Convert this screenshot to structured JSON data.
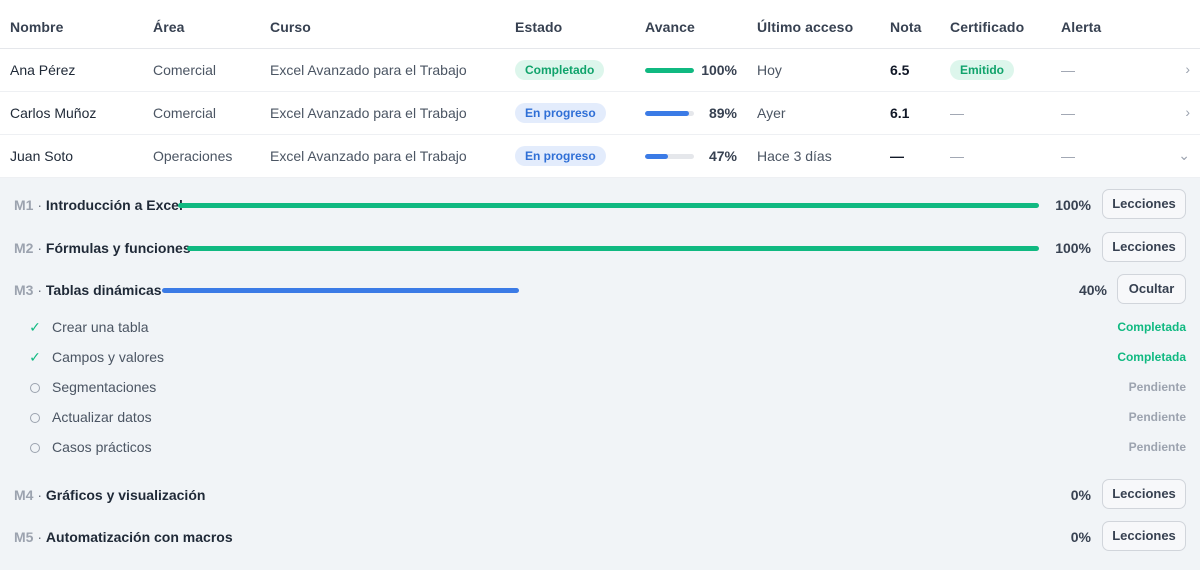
{
  "headers": {
    "nombre": "Nombre",
    "area": "Área",
    "curso": "Curso",
    "estado": "Estado",
    "avance": "Avance",
    "ultimo_acceso": "Último acceso",
    "nota": "Nota",
    "certificado": "Certificado",
    "alerta": "Alerta"
  },
  "rows": [
    {
      "nombre": "Ana Pérez",
      "area": "Comercial",
      "curso": "Excel Avanzado para el Trabajo",
      "estado": "Completado",
      "avance": "100%",
      "progress": 1.0,
      "ultimo_acceso": "Hoy",
      "nota": "6.5",
      "certificado": "Emitido",
      "alerta": "—",
      "chevron": "›"
    },
    {
      "nombre": "Carlos Muñoz",
      "area": "Comercial",
      "curso": "Excel Avanzado para el Trabajo",
      "estado": "En progreso",
      "avance": "89%",
      "progress": 0.89,
      "ultimo_acceso": "Ayer",
      "nota": "6.1",
      "certificado": "—",
      "alerta": "—",
      "chevron": "›"
    },
    {
      "nombre": "Juan Soto",
      "area": "Operaciones",
      "curso": "Excel Avanzado para el Trabajo",
      "estado": "En progreso",
      "avance": "47%",
      "progress": 0.47,
      "ultimo_acceso": "Hace 3 días",
      "nota": "—",
      "certificado": "—",
      "alerta": "—",
      "chevron": "⌄"
    }
  ],
  "modules": [
    {
      "code": "M1",
      "sep": " · ",
      "name": "Introducción a Excel",
      "pct": "100%",
      "progress": 1.0,
      "button": "Lecciones"
    },
    {
      "code": "M2",
      "sep": " · ",
      "name": "Fórmulas y funciones",
      "pct": "100%",
      "progress": 1.0,
      "button": "Lecciones"
    },
    {
      "code": "M3",
      "sep": " · ",
      "name": "Tablas dinámicas",
      "pct": "40%",
      "progress": 0.4,
      "button": "Ocultar"
    },
    {
      "code": "M4",
      "sep": " · ",
      "name": "Gráficos y visualización",
      "pct": "0%",
      "progress": 0.0,
      "button": "Lecciones"
    },
    {
      "code": "M5",
      "sep": " · ",
      "name": "Automatización con macros",
      "pct": "0%",
      "progress": 0.0,
      "button": "Lecciones"
    }
  ],
  "lessons": [
    {
      "name": "Crear una tabla",
      "status": "Completada",
      "icon": "check-icon",
      "icon_glyph": "✓"
    },
    {
      "name": "Campos y valores",
      "status": "Completada",
      "icon": "check-icon",
      "icon_glyph": "✓"
    },
    {
      "name": "Segmentaciones",
      "status": "Pendiente",
      "icon": "circle-icon"
    },
    {
      "name": "Actualizar datos",
      "status": "Pendiente",
      "icon": "circle-icon"
    },
    {
      "name": "Casos prácticos",
      "status": "Pendiente",
      "icon": "circle-icon"
    }
  ],
  "colors": {
    "green": "#10b981",
    "blue": "#3b7be6",
    "track": "#e5e7eb"
  }
}
